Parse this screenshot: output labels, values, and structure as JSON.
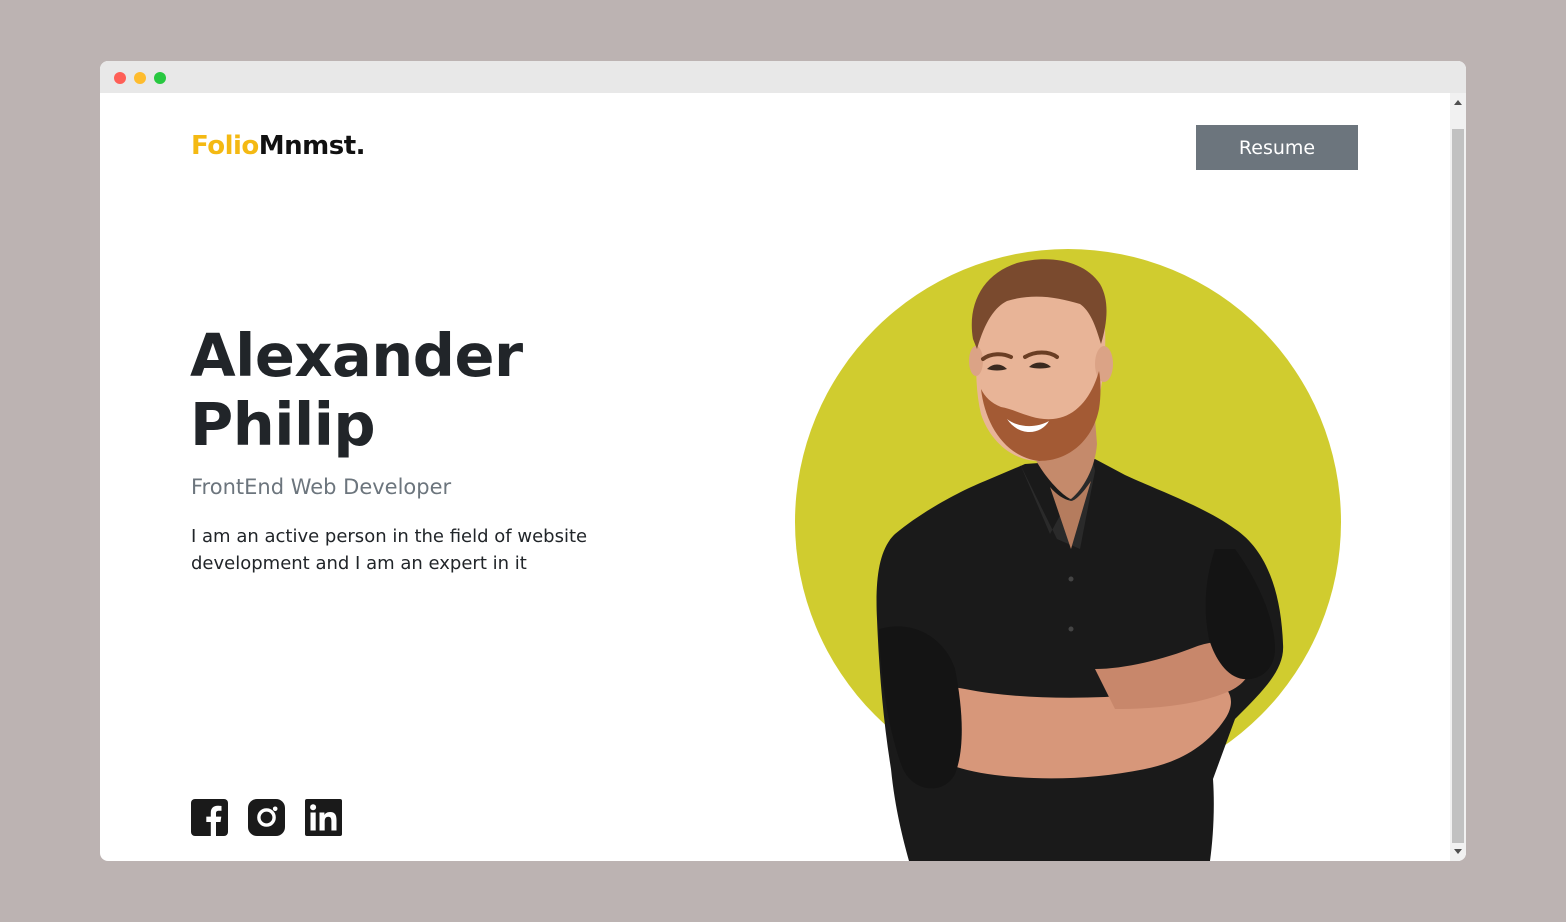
{
  "window": {
    "controls": [
      "close",
      "minimize",
      "maximize"
    ]
  },
  "header": {
    "logo_accent": "Folio",
    "logo_rest": "Mnmst.",
    "resume_label": "Resume"
  },
  "hero": {
    "name_line1": "Alexander",
    "name_line2": "Philip",
    "role": "FrontEnd Web Developer",
    "description": "I am an active person in the field of website development and I am an expert in it"
  },
  "socials": [
    {
      "icon": "facebook-icon"
    },
    {
      "icon": "instagram-icon"
    },
    {
      "icon": "linkedin-icon"
    }
  ],
  "colors": {
    "accent": "#f4b913",
    "button": "#6c757d",
    "circle": "#d0cc2f",
    "background": "#bcb3b2",
    "text": "#212529"
  }
}
